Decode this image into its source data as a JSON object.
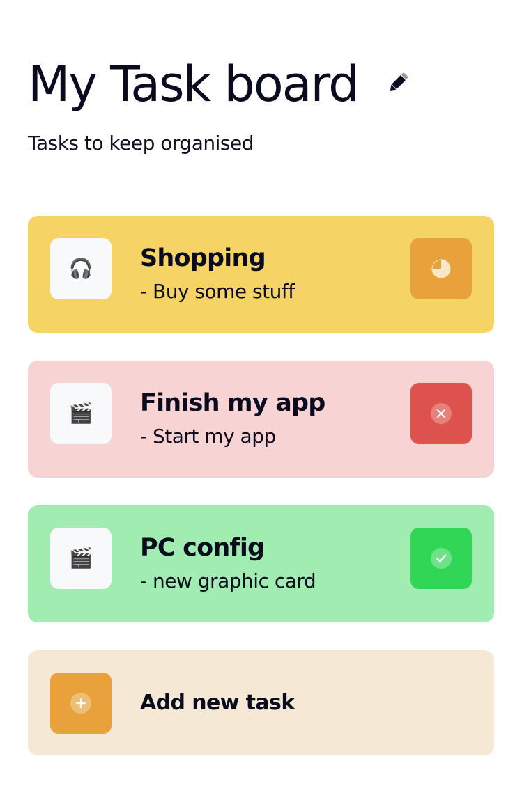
{
  "header": {
    "title": "My Task board",
    "subtitle": "Tasks to keep organised",
    "edit_icon": "pencil-icon"
  },
  "tasks": [
    {
      "title": "Shopping",
      "description": "- Buy some stuff",
      "icon": "headphones-icon",
      "icon_glyph": "🎧",
      "status": "in-progress",
      "status_icon": "clock-icon",
      "card_color": "#F5D365",
      "status_color": "#E9A23B"
    },
    {
      "title": "Finish my app",
      "description": "- Start my app",
      "icon": "clapper-board-icon",
      "icon_glyph": "🎬",
      "status": "wont-do",
      "status_icon": "close-icon",
      "card_color": "#F7D3D3",
      "status_color": "#DD524C"
    },
    {
      "title": "PC config",
      "description": "- new graphic card",
      "icon": "clapper-board-icon",
      "icon_glyph": "🎬",
      "status": "completed",
      "status_icon": "check-icon",
      "card_color": "#A0ECB1",
      "status_color": "#32D657"
    }
  ],
  "add_task": {
    "label": "Add new task",
    "icon": "plus-icon",
    "card_color": "#F5E8D5",
    "button_color": "#E9A23B"
  }
}
